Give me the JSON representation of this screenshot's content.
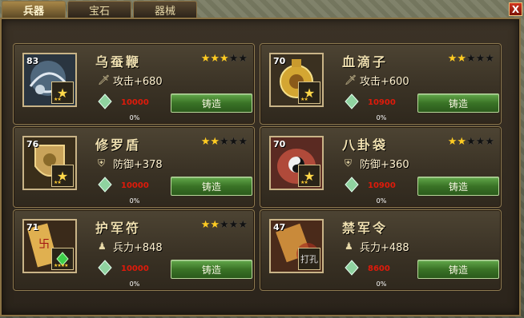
{
  "tabs": [
    {
      "label": "兵器",
      "active": true
    },
    {
      "label": "宝石",
      "active": false
    },
    {
      "label": "器械",
      "active": false
    }
  ],
  "close_label": "X",
  "items": [
    {
      "level": "83",
      "name": "乌蚕鞭",
      "stars": 3,
      "stat_icon": "sword-icon",
      "stat": "攻击+680",
      "cost": "10000",
      "forge_label": "铸造",
      "progress": "0%",
      "badge_icon": "star-icon",
      "badge_stars": "★★"
    },
    {
      "level": "70",
      "name": "血滴子",
      "stars": 2,
      "stat_icon": "sword-icon",
      "stat": "攻击+600",
      "cost": "10900",
      "forge_label": "铸造",
      "progress": "0%",
      "badge_icon": "star-icon",
      "badge_stars": "★★"
    },
    {
      "level": "76",
      "name": "修罗盾",
      "stars": 2,
      "stat_icon": "shield-icon",
      "stat": "防御+378",
      "cost": "10000",
      "forge_label": "铸造",
      "progress": "0%",
      "badge_icon": "star-icon",
      "badge_stars": "★★"
    },
    {
      "level": "70",
      "name": "八卦袋",
      "stars": 2,
      "stat_icon": "shield-icon",
      "stat": "防御+360",
      "cost": "10900",
      "forge_label": "铸造",
      "progress": "0%",
      "badge_icon": "star-icon",
      "badge_stars": "★★"
    },
    {
      "level": "71",
      "name": "护军符",
      "stars": 2,
      "stat_icon": "soldier-icon",
      "stat": "兵力+848",
      "cost": "10000",
      "forge_label": "铸造",
      "progress": "0%",
      "badge_icon": "gem-icon",
      "badge_stars": "★★★★"
    },
    {
      "level": "47",
      "name": "禁军令",
      "stars": 0,
      "stat_icon": "soldier-icon",
      "stat": "兵力+488",
      "cost": "8600",
      "forge_label": "铸造",
      "progress": "0%",
      "badge_icon": "seal-icon",
      "badge_stars": ""
    }
  ],
  "colors": {
    "accent": "#8a7244",
    "cost": "#e01a0a",
    "button": "#3a7326",
    "star_on": "#ffcc22"
  }
}
